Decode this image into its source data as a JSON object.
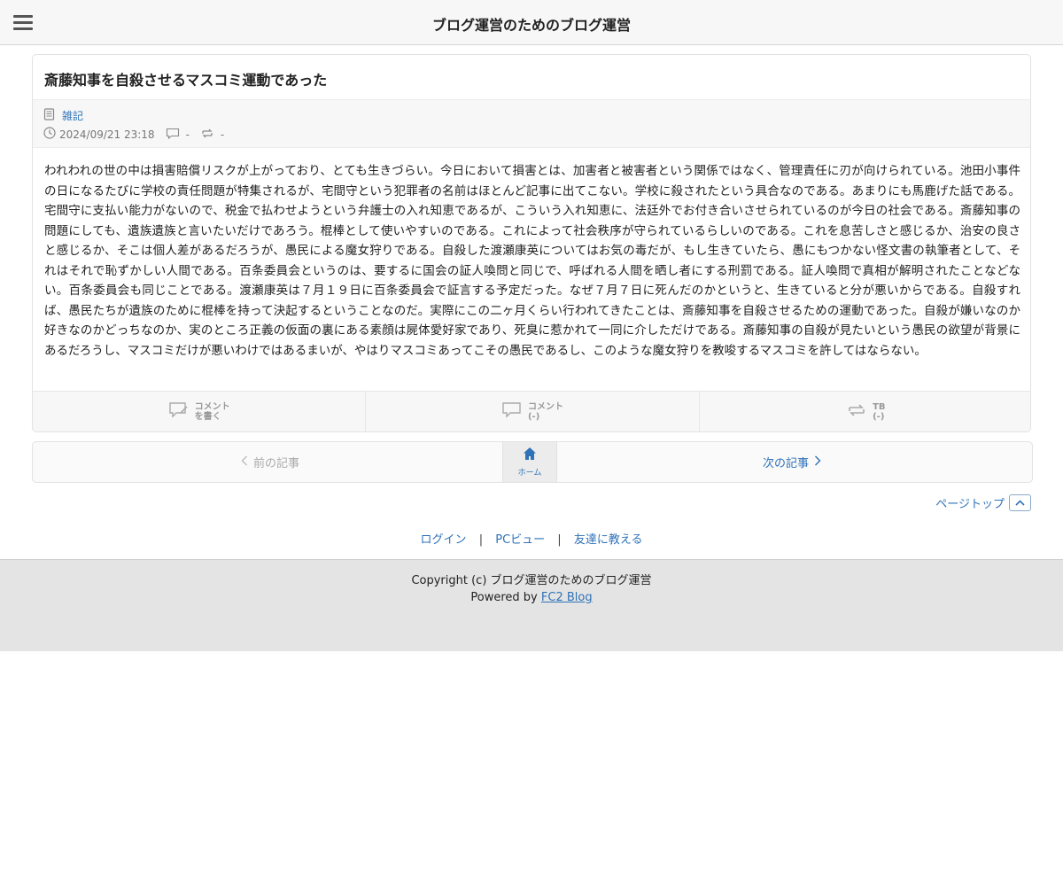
{
  "header": {
    "site_title": "ブログ運営のためのブログ運営"
  },
  "article": {
    "title": "斎藤知事を自殺させるマスコミ運動であった",
    "category": "雑記",
    "datetime": "2024/09/21 23:18",
    "comment_count": "-",
    "trackback_count": "-",
    "body": "われわれの世の中は損害賠償リスクが上がっており、とても生きづらい。今日において損害とは、加害者と被害者という関係ではなく、管理責任に刃が向けられている。池田小事件の日になるたびに学校の責任問題が特集されるが、宅間守という犯罪者の名前はほとんど記事に出てこない。学校に殺されたという具合なのである。あまりにも馬鹿げた話である。宅間守に支払い能力がないので、税金で払わせようという弁護士の入れ知恵であるが、こういう入れ知恵に、法廷外でお付き合いさせられているのが今日の社会である。斎藤知事の問題にしても、遺族遺族と言いたいだけであろう。棍棒として使いやすいのである。これによって社会秩序が守られているらしいのである。これを息苦しさと感じるか、治安の良さと感じるか、そこは個人差があるだろうが、愚民による魔女狩りである。自殺した渡瀬康英についてはお気の毒だが、もし生きていたら、愚にもつかない怪文書の執筆者として、それはそれで恥ずかしい人間である。百条委員会というのは、要するに国会の証人喚問と同じで、呼ばれる人間を晒し者にする刑罰である。証人喚問で真相が解明されたことなどない。百条委員会も同じことである。渡瀬康英は７月１９日に百条委員会で証言する予定だった。なぜ７月７日に死んだのかというと、生きていると分が悪いからである。自殺すれば、愚民たちが遺族のために棍棒を持って決起するということなのだ。実際にこの二ヶ月くらい行われてきたことは、斎藤知事を自殺させるための運動であった。自殺が嫌いなのか好きなのかどっちなのか、実のところ正義の仮面の裏にある素顔は屍体愛好家であり、死臭に惹かれて一同に介しただけである。斎藤知事の自殺が見たいという愚民の欲望が背景にあるだろうし、マスコミだけが悪いわけではあるまいが、やはりマスコミあってこその愚民であるし、このような魔女狩りを教唆するマスコミを許してはならない。"
  },
  "actions": {
    "write_comment": {
      "line1": "コメント",
      "line2": "を書く"
    },
    "comments": {
      "line1": "コメント",
      "line2": "(-)"
    },
    "trackback": {
      "line1": "TB",
      "line2": "(-)"
    }
  },
  "pager": {
    "prev_label": "前の記事",
    "home_label": "ホーム",
    "next_label": "次の記事"
  },
  "pagetop_label": "ページトップ",
  "footer_links": {
    "login": "ログイン",
    "pc_view": "PCビュー",
    "tell_friend": "友達に教える",
    "separator": "|"
  },
  "footer": {
    "copyright": "Copyright (c) ブログ運営のためのブログ運営",
    "powered_prefix": "Powered by",
    "powered_link": "FC2 Blog"
  },
  "colors": {
    "link": "#2f72b8",
    "header_bg": "#f7f7f7",
    "footer_bg": "#e4e4e4"
  }
}
